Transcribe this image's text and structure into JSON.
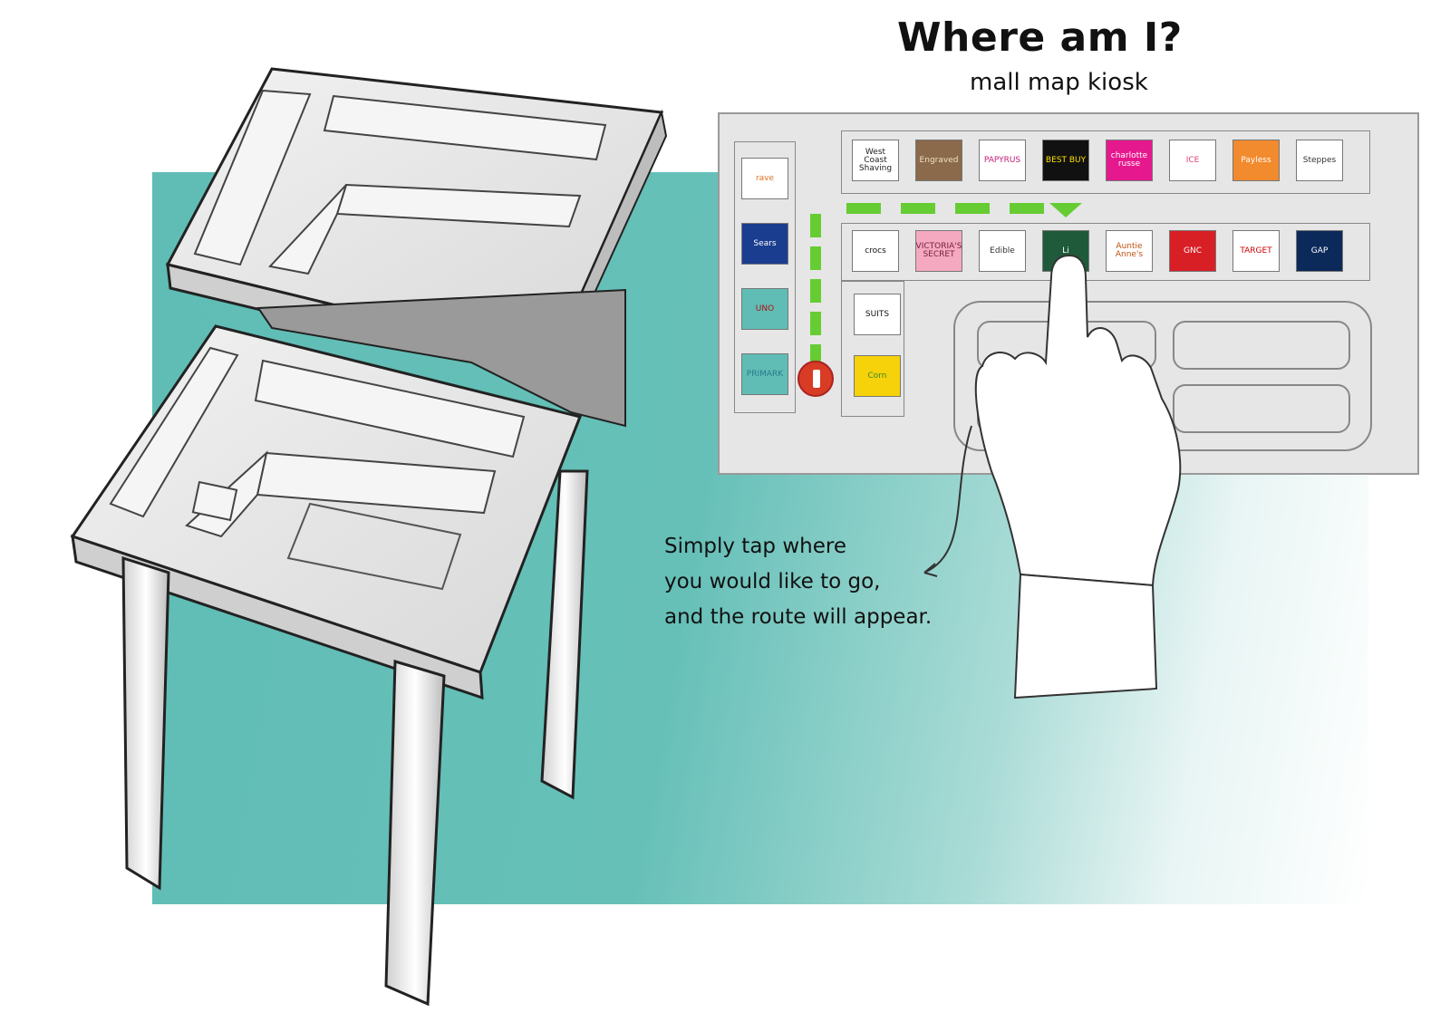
{
  "header": {
    "title": "Where am I?",
    "subtitle": "mall map kiosk"
  },
  "caption": {
    "lines": [
      "Simply tap where",
      "you would like to go,",
      "and the route will appear."
    ]
  },
  "map": {
    "top_row": [
      {
        "label": "West Coast Shaving",
        "bg": "#ffffff",
        "fg": "#222222"
      },
      {
        "label": "Engraved",
        "bg": "#8a6a4a",
        "fg": "#f0e0c0"
      },
      {
        "label": "PAPYRUS",
        "bg": "#ffffff",
        "fg": "#c0207a"
      },
      {
        "label": "BEST BUY",
        "bg": "#111111",
        "fg": "#ffe000"
      },
      {
        "label": "charlotte russe",
        "bg": "#e6188e",
        "fg": "#ffffff"
      },
      {
        "label": "ICE",
        "bg": "#ffffff",
        "fg": "#e04070"
      },
      {
        "label": "Payless",
        "bg": "#f28a2e",
        "fg": "#ffffff"
      },
      {
        "label": "Steppes",
        "bg": "#ffffff",
        "fg": "#333333"
      }
    ],
    "middle_row": [
      {
        "label": "crocs",
        "bg": "#ffffff",
        "fg": "#111111"
      },
      {
        "label": "VICTORIA'S SECRET",
        "bg": "#f4a9c0",
        "fg": "#7a2040"
      },
      {
        "label": "Edible",
        "bg": "#ffffff",
        "fg": "#333333"
      },
      {
        "label": "Li",
        "bg": "#1f5a3a",
        "fg": "#ffffff"
      },
      {
        "label": "Auntie Anne's",
        "bg": "#ffffff",
        "fg": "#c05010"
      },
      {
        "label": "GNC",
        "bg": "#d81f26",
        "fg": "#ffffff"
      },
      {
        "label": "TARGET",
        "bg": "#ffffff",
        "fg": "#cc0000"
      },
      {
        "label": "GAP",
        "bg": "#0b2a5a",
        "fg": "#ffffff"
      }
    ],
    "left_column": [
      {
        "label": "rave",
        "bg": "#ffffff",
        "fg": "#e07020"
      },
      {
        "label": "Sears",
        "bg": "#1a3d8f",
        "fg": "#ffffff"
      },
      {
        "label": "UNO",
        "bg": "#5fbdb5",
        "fg": "#b01010"
      },
      {
        "label": "PRIMARK",
        "bg": "#5fbdb5",
        "fg": "#2a7a8a"
      }
    ],
    "inner_column": [
      {
        "label": "SUITS",
        "bg": "#ffffff",
        "fg": "#111111"
      },
      {
        "label": "Corn",
        "bg": "#f5d20a",
        "fg": "#3a8a2a"
      }
    ],
    "route_color": "#66cc33",
    "you_are_here_color": "#d83c24"
  }
}
